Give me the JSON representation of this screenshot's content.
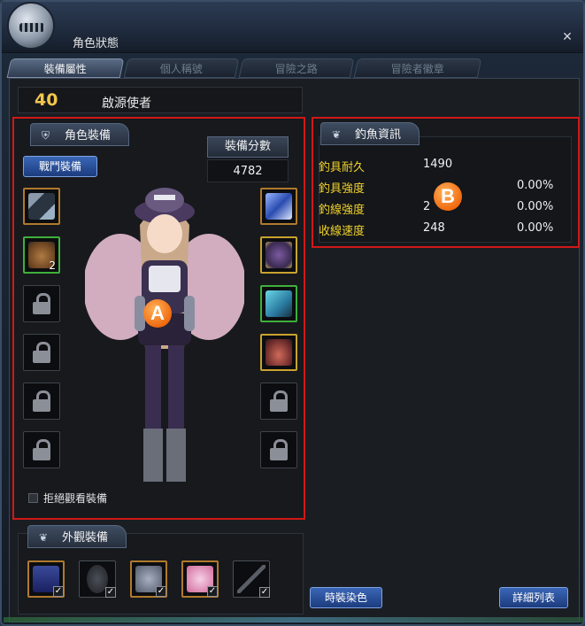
{
  "window": {
    "title": "角色狀態",
    "close_glyph": "✕"
  },
  "tabs": [
    {
      "label": "裝備屬性",
      "active": true
    },
    {
      "label": "個人稱號",
      "active": false
    },
    {
      "label": "冒險之路",
      "active": false
    },
    {
      "label": "冒險者徽章",
      "active": false
    }
  ],
  "character": {
    "level": "40",
    "name": "啟源使者"
  },
  "equipment": {
    "header": "角色裝備",
    "battle_button": "戰鬥裝備",
    "score_label": "裝備分數",
    "score_value": "4782",
    "marker": "A",
    "left_slots": [
      {
        "state": "filled",
        "icon": "sword-icon",
        "border": "orange"
      },
      {
        "state": "filled",
        "icon": "pouch-icon",
        "border": "green",
        "count": "2"
      },
      {
        "state": "locked",
        "icon": "lock-icon"
      },
      {
        "state": "locked",
        "icon": "lock-icon"
      },
      {
        "state": "locked",
        "icon": "lock-icon"
      },
      {
        "state": "locked",
        "icon": "lock-icon"
      }
    ],
    "right_slots": [
      {
        "state": "filled",
        "icon": "crystal-icon",
        "border": "orange"
      },
      {
        "state": "filled",
        "icon": "armor-icon",
        "border": "gold"
      },
      {
        "state": "filled",
        "icon": "gauntlet-icon",
        "border": "green"
      },
      {
        "state": "filled",
        "icon": "boots-icon",
        "border": "gold"
      },
      {
        "state": "locked",
        "icon": "lock-icon"
      },
      {
        "state": "locked",
        "icon": "lock-icon"
      }
    ],
    "refuse_view_label": "拒絕觀看裝備"
  },
  "fishing": {
    "header": "釣魚資訊",
    "marker": "B",
    "rows": [
      {
        "label": "釣具耐久",
        "value": "1490",
        "percent": ""
      },
      {
        "label": "釣具強度",
        "value": "",
        "percent": "0.00%"
      },
      {
        "label": "釣線強度",
        "value": "2",
        "percent": "0.00%"
      },
      {
        "label": "收線速度",
        "value": "248",
        "percent": "0.00%"
      }
    ]
  },
  "appearance": {
    "header": "外觀裝備",
    "slots": [
      {
        "icon": "hat-icon",
        "checked": true
      },
      {
        "icon": "mask-icon",
        "checked": true
      },
      {
        "icon": "robe-icon",
        "checked": true
      },
      {
        "icon": "wings-icon",
        "checked": true
      },
      {
        "icon": "weapon-skin-icon",
        "checked": true
      }
    ],
    "check_glyph": "✓"
  },
  "footer": {
    "dye_button": "時裝染色",
    "detail_button": "詳細列表"
  },
  "colors": {
    "level": "#f4c64c",
    "fish_label": "#f0d22c",
    "highlight_border": "#d01818",
    "button": "#2a4f98"
  }
}
